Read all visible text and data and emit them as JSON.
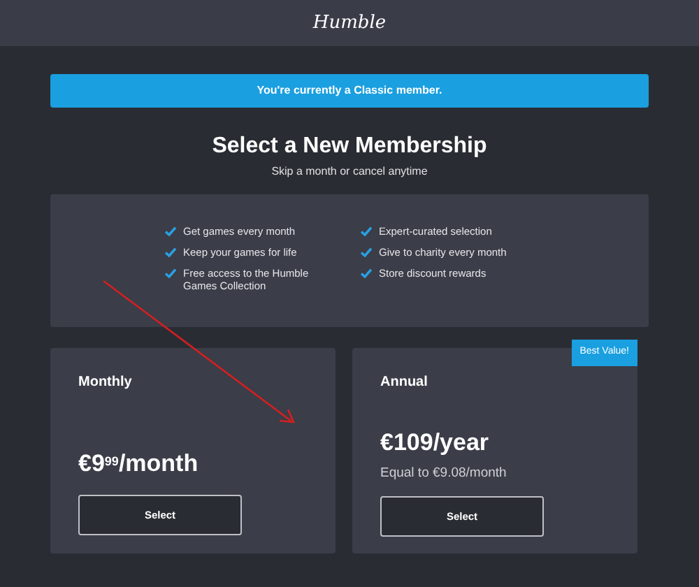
{
  "header": {
    "logo": "Humble"
  },
  "banner": {
    "text": "You're currently a Classic member."
  },
  "heading": {
    "title": "Select a New Membership",
    "subtitle": "Skip a month or cancel anytime"
  },
  "features": [
    {
      "text": "Get games every month"
    },
    {
      "text": "Keep your games for life"
    },
    {
      "text": "Free access to the Humble Games Collection"
    },
    {
      "text": "Expert-curated selection"
    },
    {
      "text": "Give to charity every month"
    },
    {
      "text": "Store discount rewards"
    }
  ],
  "plans": [
    {
      "name": "Monthly",
      "price": "€9$^{99}$/month",
      "button": "Select"
    },
    {
      "name": "Annual",
      "badge": "Best Value!",
      "price": "€109/year",
      "note": "Equal to €9.08/month",
      "button": "Select"
    }
  ],
  "annotation": {
    "kind": "arrow"
  }
}
